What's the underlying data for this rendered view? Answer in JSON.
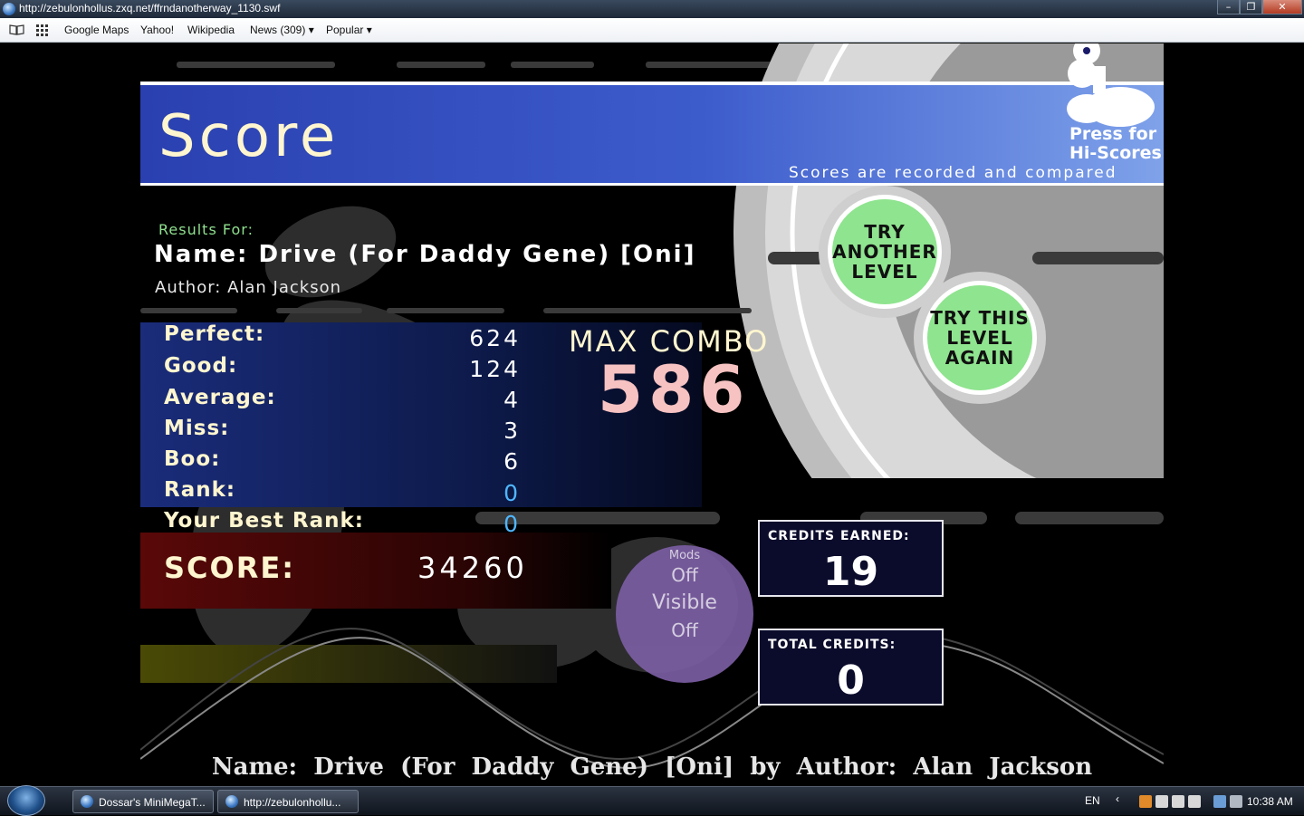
{
  "window": {
    "title": "http://zebulonhollus.zxq.net/ffrndanotherway_1130.swf",
    "buttons": {
      "minimize": "–",
      "maximize": "❐",
      "close": "✕"
    }
  },
  "bookmarks": {
    "items": [
      {
        "label": "Google Maps"
      },
      {
        "label": "Yahoo!"
      },
      {
        "label": "Wikipedia"
      },
      {
        "label": "News (309) ▾"
      },
      {
        "label": "Popular ▾"
      }
    ]
  },
  "game": {
    "header_title": "Score",
    "hiscores": {
      "line1": "Press for",
      "line2": "Hi-Scores",
      "note": "Scores are recorded and compared"
    },
    "results_for": "Results For:",
    "name_line": "Name: Drive (For Daddy Gene) [Oni]",
    "author_line": "Author: Alan Jackson",
    "stats": [
      {
        "label": "Perfect:",
        "value": "624"
      },
      {
        "label": "Good:",
        "value": "124"
      },
      {
        "label": "Average:",
        "value": "4"
      },
      {
        "label": "Miss:",
        "value": "3"
      },
      {
        "label": "Boo:",
        "value": "6"
      },
      {
        "label": "Rank:",
        "value": "0"
      },
      {
        "label": "Your Best Rank:",
        "value": "0"
      }
    ],
    "score_label": "SCORE:",
    "score_value": "34260",
    "max_combo_label": "MAX COMBO",
    "max_combo_value": "586",
    "buttons": {
      "try_another": [
        "TRY",
        "ANOTHER",
        "LEVEL"
      ],
      "try_this": [
        "TRY THIS",
        "LEVEL",
        "AGAIN"
      ]
    },
    "mods": {
      "title": "Mods",
      "lines": [
        "Off",
        "Visible",
        "Off"
      ]
    },
    "credits_earned": {
      "label": "CREDITS EARNED:",
      "value": "19"
    },
    "total_credits": {
      "label": "TOTAL CREDITS:",
      "value": "0"
    },
    "footer": "Name:  Drive  (For  Daddy  Gene)  [Oni]  by  Author:  Alan  Jackson"
  },
  "taskbar": {
    "tasks": [
      {
        "label": "Dossar's MiniMegaT..."
      },
      {
        "label": "http://zebulonhollu..."
      }
    ],
    "language": "EN",
    "clock": "10:38 AM"
  },
  "colors": {
    "header_blue": "#2f48b8",
    "header_blue_light": "#6f8fe0",
    "title_cream": "#fff6cf",
    "results_green": "#8fe08f",
    "combo_pink": "#f7c2c2",
    "rank_blue": "#4fb6ff",
    "mods_purple": "#7d5fa6",
    "button_green": "#8fe48f"
  }
}
